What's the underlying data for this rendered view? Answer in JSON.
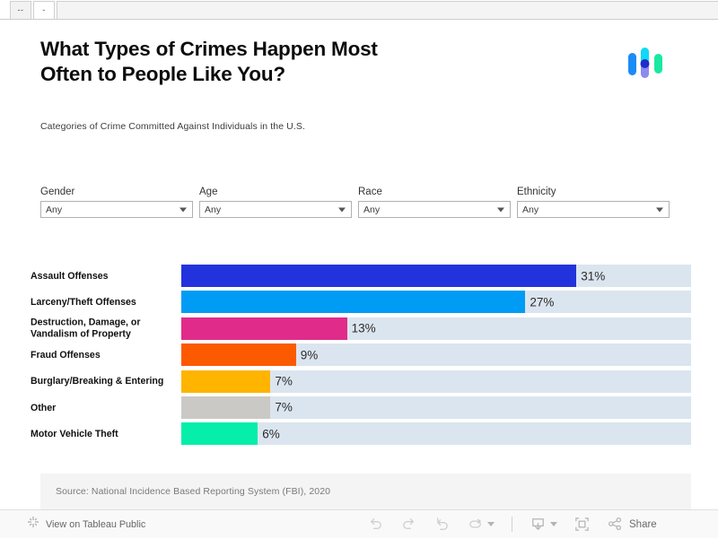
{
  "tabs": [
    {
      "label": "--",
      "active": false
    },
    {
      "label": "-",
      "active": true
    }
  ],
  "viz": {
    "headline": "What Types of Crimes Happen Most Often to People Like You?",
    "subhead": "Categories of Crime Committed Against Individuals in the U.S.",
    "logo_name": "tableau-public-logo"
  },
  "filters": [
    {
      "label": "Gender",
      "value": "Any",
      "name": "filter-gender"
    },
    {
      "label": "Age",
      "value": "Any",
      "name": "filter-age"
    },
    {
      "label": "Race",
      "value": "Any",
      "name": "filter-race"
    },
    {
      "label": "Ethnicity",
      "value": "Any",
      "name": "filter-ethnicity"
    }
  ],
  "chart_data": {
    "type": "bar",
    "title": "What Types of Crimes Happen Most Often to People Like You?",
    "subtitle": "Categories of Crime Committed Against Individuals in the U.S.",
    "orientation": "horizontal",
    "xlabel": "",
    "ylabel": "",
    "xlim": [
      0,
      40
    ],
    "grid": false,
    "legend": "none",
    "track_color": "#dbe5ef",
    "categories": [
      "Assault Offenses",
      "Larceny/Theft Offenses",
      "Destruction, Damage, or Vandalism of Property",
      "Fraud Offenses",
      "Burglary/Breaking & Entering",
      "Other",
      "Motor Vehicle Theft"
    ],
    "values": [
      31,
      27,
      13,
      9,
      7,
      7,
      6
    ],
    "labels": [
      "31%",
      "27%",
      "13%",
      "9%",
      "7%",
      "7%",
      "6%"
    ],
    "colors": [
      "#2233dd",
      "#009bf5",
      "#e02b8a",
      "#fc5a00",
      "#ffb400",
      "#cbc9c5",
      "#05eeaa"
    ],
    "bars": [
      {
        "category": "Assault Offenses",
        "value": 31,
        "label": "31%",
        "color": "#2233dd",
        "label_inside": false
      },
      {
        "category": "Larceny/Theft Offenses",
        "value": 27,
        "label": "27%",
        "color": "#009bf5",
        "label_inside": false
      },
      {
        "category": "Destruction, Damage, or Vandalism of Property",
        "value": 13,
        "label": "13%",
        "color": "#e02b8a",
        "label_inside": false
      },
      {
        "category": "Fraud Offenses",
        "value": 9,
        "label": "9%",
        "color": "#fc5a00",
        "label_inside": false
      },
      {
        "category": "Burglary/Breaking & Entering",
        "value": 7,
        "label": "7%",
        "color": "#ffb400",
        "label_inside": false
      },
      {
        "category": "Other",
        "value": 7,
        "label": "7%",
        "color": "#cbc9c5",
        "label_inside": false
      },
      {
        "category": "Motor Vehicle Theft",
        "value": 6,
        "label": "6%",
        "color": "#05eeaa",
        "label_inside": false
      }
    ]
  },
  "source": {
    "text": "Source: National Incidence Based Reporting System (FBI), 2020"
  },
  "toolbar": {
    "view_label": "View on Tableau Public",
    "share_label": "Share",
    "buttons": [
      {
        "name": "undo-button",
        "icon": "undo-icon"
      },
      {
        "name": "redo-button",
        "icon": "redo-icon"
      },
      {
        "name": "revert-button",
        "icon": "revert-icon"
      },
      {
        "name": "refresh-button",
        "icon": "refresh-icon"
      },
      {
        "name": "download-button",
        "icon": "download-icon"
      },
      {
        "name": "fullscreen-button",
        "icon": "fullscreen-icon"
      },
      {
        "name": "share-button",
        "icon": "share-icon"
      }
    ]
  }
}
